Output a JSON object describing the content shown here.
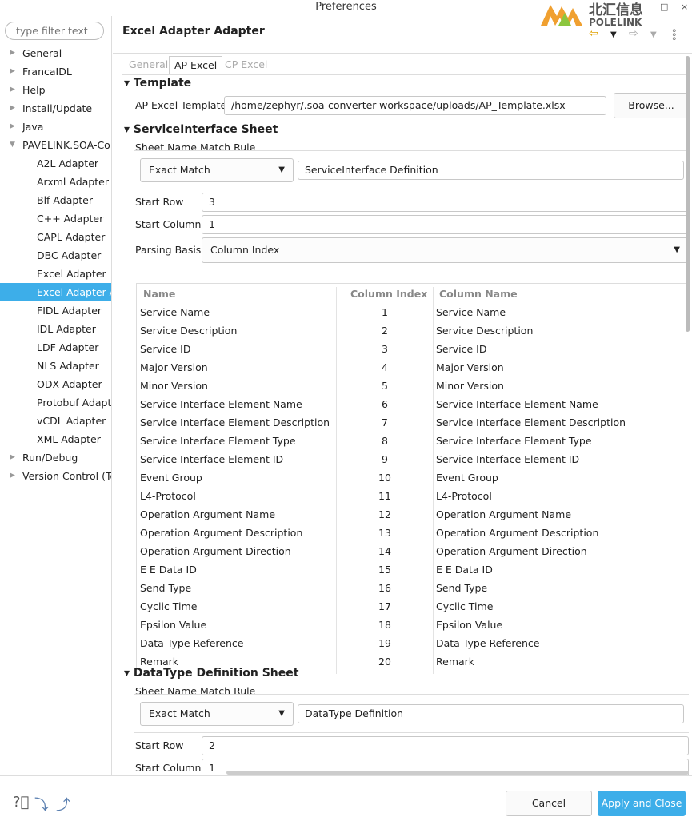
{
  "window": {
    "title": "Preferences",
    "logo_text": "北汇信息 POLELINK",
    "maximize": "□",
    "close": "×"
  },
  "sidebar": {
    "filter_placeholder": "type filter text",
    "items": [
      {
        "label": "General",
        "level": 0,
        "expandable": true
      },
      {
        "label": "FrancaIDL",
        "level": 0,
        "expandable": true
      },
      {
        "label": "Help",
        "level": 0,
        "expandable": true
      },
      {
        "label": "Install/Update",
        "level": 0,
        "expandable": true
      },
      {
        "label": "Java",
        "level": 0,
        "expandable": true
      },
      {
        "label": "PAVELINK.SOA-Co",
        "level": 0,
        "expanded": true
      },
      {
        "label": "A2L Adapter",
        "level": 1
      },
      {
        "label": "Arxml Adapter",
        "level": 1
      },
      {
        "label": "Blf Adapter",
        "level": 1
      },
      {
        "label": "C++ Adapter",
        "level": 1
      },
      {
        "label": "CAPL Adapter",
        "level": 1
      },
      {
        "label": "DBC Adapter",
        "level": 1
      },
      {
        "label": "Excel Adapter",
        "level": 1
      },
      {
        "label": "Excel Adapter A",
        "level": 1,
        "selected": true
      },
      {
        "label": "FIDL Adapter",
        "level": 1
      },
      {
        "label": "IDL Adapter",
        "level": 1
      },
      {
        "label": "LDF Adapter",
        "level": 1
      },
      {
        "label": "NLS Adapter",
        "level": 1
      },
      {
        "label": "ODX Adapter",
        "level": 1
      },
      {
        "label": "Protobuf Adapt",
        "level": 1
      },
      {
        "label": "vCDL Adapter",
        "level": 1
      },
      {
        "label": "XML Adapter",
        "level": 1
      },
      {
        "label": "Run/Debug",
        "level": 0,
        "expandable": true
      },
      {
        "label": "Version Control (Te",
        "level": 0,
        "expandable": true
      }
    ]
  },
  "header": {
    "title": "Excel Adapter Adapter",
    "back_icon": "arrow-left-icon",
    "forward_icon": "arrow-right-icon",
    "menu_icon": "more-vertical-icon"
  },
  "tabs": [
    {
      "label": "General"
    },
    {
      "label": "AP Excel",
      "active": true
    },
    {
      "label": "CP Excel"
    }
  ],
  "template": {
    "section": "Template",
    "label": "AP Excel Template",
    "value": "/home/zephyr/.soa-converter-workspace/uploads/AP_Template.xlsx",
    "browse": "Browse..."
  },
  "si_sheet": {
    "section": "ServiceInterface Sheet",
    "match_group": "Sheet Name Match Rule",
    "match_rule": "Exact Match",
    "sheet_name": "ServiceInterface Definition",
    "start_row_label": "Start Row",
    "start_row": "3",
    "start_col_label": "Start Column",
    "start_col": "1",
    "parsing_label": "Parsing Basis",
    "parsing": "Column Index",
    "columns": [
      "Name",
      "Column Index",
      "Column Name"
    ],
    "rows": [
      [
        "Service Name",
        "1",
        "Service Name"
      ],
      [
        "Service Description",
        "2",
        "Service Description"
      ],
      [
        "Service ID",
        "3",
        "Service ID"
      ],
      [
        "Major Version",
        "4",
        "Major Version"
      ],
      [
        "Minor Version",
        "5",
        "Minor Version"
      ],
      [
        "Service Interface Element Name",
        "6",
        "Service Interface Element Name"
      ],
      [
        "Service Interface Element Description",
        "7",
        "Service Interface Element Description"
      ],
      [
        "Service Interface Element Type",
        "8",
        "Service Interface Element Type"
      ],
      [
        "Service Interface Element ID",
        "9",
        "Service Interface Element ID"
      ],
      [
        "Event Group",
        "10",
        "Event Group"
      ],
      [
        "L4-Protocol",
        "11",
        "L4-Protocol"
      ],
      [
        "Operation Argument Name",
        "12",
        "Operation Argument Name"
      ],
      [
        "Operation Argument Description",
        "13",
        "Operation Argument Description"
      ],
      [
        "Operation Argument Direction",
        "14",
        "Operation Argument Direction"
      ],
      [
        "E E Data ID",
        "15",
        "E E Data ID"
      ],
      [
        "Send Type",
        "16",
        "Send Type"
      ],
      [
        "Cyclic Time",
        "17",
        "Cyclic Time"
      ],
      [
        "Epsilon Value",
        "18",
        "Epsilon Value"
      ],
      [
        "Data Type Reference",
        "19",
        "Data Type Reference"
      ],
      [
        "Remark",
        "20",
        "Remark"
      ]
    ]
  },
  "dt_sheet": {
    "section": "DataType Definition Sheet",
    "match_group": "Sheet Name Match Rule",
    "match_rule": "Exact Match",
    "sheet_name": "DataType Definition",
    "start_row_label": "Start Row",
    "start_row": "2",
    "start_col_label": "Start Column",
    "start_col": "1"
  },
  "footer": {
    "cancel": "Cancel",
    "apply": "Apply and Close",
    "accent": "#3daee9"
  }
}
